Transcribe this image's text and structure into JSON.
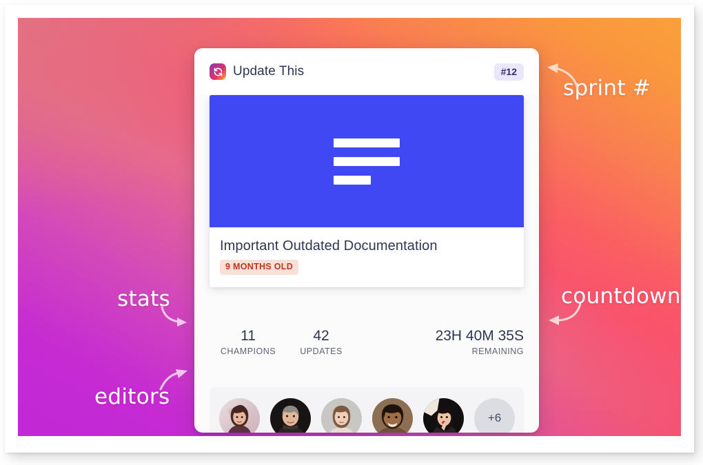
{
  "colors": {
    "card_bg": "#fbfbfc",
    "hero_blue": "#4048f4",
    "badge_lavender": "#ebe7fa",
    "badge_lavender_text": "#3b2a7a",
    "age_badge_bg": "#fbe0d8",
    "age_badge_text": "#c0341a",
    "gradient_magenta": "#c128d6",
    "gradient_pink": "#fa4c68",
    "gradient_orange": "#fba03a",
    "text_dark": "#2e3650",
    "panel_gray": "#f4f4f6"
  },
  "card": {
    "header": {
      "logo_icon": "sync-refresh-icon",
      "app_title": "Update This",
      "sprint_badge": "#12"
    },
    "hero": {
      "placeholder_icon": "document-lines-icon",
      "bars": [
        "long",
        "long",
        "short"
      ]
    },
    "document": {
      "title": "Important Outdated Documentation",
      "age_badge": "9 MONTHS OLD"
    },
    "stats": [
      {
        "name": "champions",
        "value": "11",
        "caption": "CHAMPIONS"
      },
      {
        "name": "updates",
        "value": "42",
        "caption": "UPDATES"
      },
      {
        "name": "countdown",
        "value": "23H 40M 35S",
        "caption": "REMAINING"
      }
    ],
    "editors": {
      "avatars": [
        {
          "name": "avatar-1",
          "alt": "editor photo 1"
        },
        {
          "name": "avatar-2",
          "alt": "editor photo 2"
        },
        {
          "name": "avatar-3",
          "alt": "editor photo 3"
        },
        {
          "name": "avatar-4",
          "alt": "editor photo 4"
        },
        {
          "name": "avatar-5",
          "alt": "editor photo 5"
        }
      ],
      "overflow_count": "+6"
    }
  },
  "annotations": [
    {
      "name": "sprint",
      "label": "sprint #",
      "arrow": "curved-arrow-up-left"
    },
    {
      "name": "countdown",
      "label": "countdown",
      "arrow": "curved-arrow-left"
    },
    {
      "name": "stats",
      "label": "stats",
      "arrow": "curved-arrow-down-right"
    },
    {
      "name": "editors",
      "label": "editors",
      "arrow": "curved-arrow-up-right"
    }
  ]
}
